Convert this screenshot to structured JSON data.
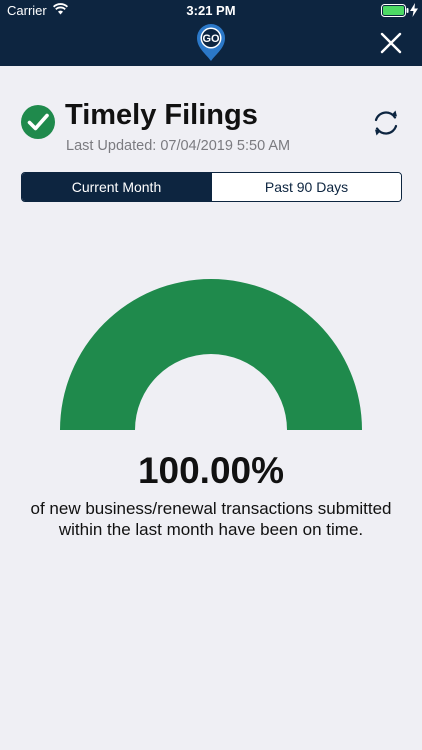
{
  "status_bar": {
    "carrier": "Carrier",
    "time": "3:21 PM"
  },
  "nav": {
    "logo_text": "GO",
    "logo_icon": "go-location-pin-logo",
    "close_icon": "close-x-icon"
  },
  "header": {
    "title": "Timely Filings",
    "last_updated": "Last Updated: 07/04/2019 5:50 AM",
    "status_icon": "green-check-circle",
    "refresh_icon": "refresh-arrows-icon"
  },
  "tabs": [
    {
      "label": "Current Month",
      "active": true
    },
    {
      "label": "Past 90 Days",
      "active": false
    }
  ],
  "gauge": {
    "value_fraction": 1.0,
    "color": "#1f8a4c"
  },
  "result": {
    "percent": "100.00%",
    "description": "of new business/renewal transactions submitted within the last month have been on time."
  },
  "colors": {
    "navy": "#0d2540",
    "green": "#1f8a4c",
    "background": "#efeff4"
  }
}
